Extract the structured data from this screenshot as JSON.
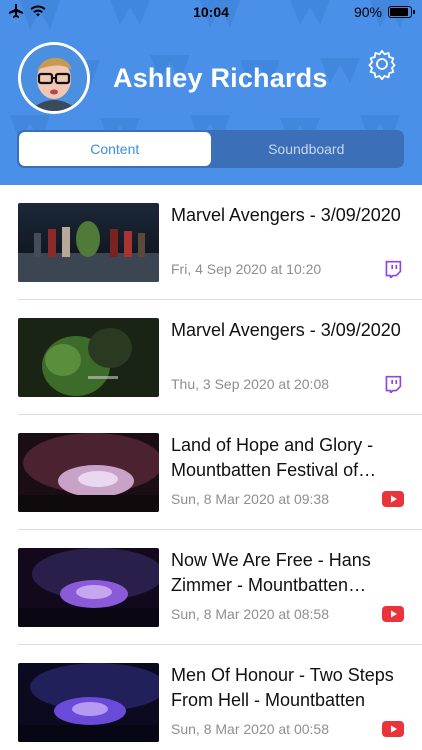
{
  "status_bar": {
    "time": "10:04",
    "battery": "90%",
    "battery_level": 0.9
  },
  "profile": {
    "name": "Ashley Richards"
  },
  "tabs": [
    {
      "label": "Content",
      "active": true
    },
    {
      "label": "Soundboard",
      "active": false
    }
  ],
  "items": [
    {
      "title": "Marvel Avengers - 3/09/2020",
      "date": "Fri, 4 Sep 2020 at 10:20",
      "source": "twitch-icon"
    },
    {
      "title": "Marvel Avengers - 3/09/2020",
      "date": "Thu, 3 Sep 2020 at 20:08",
      "source": "twitch-icon"
    },
    {
      "title": "Land of Hope and Glory - Mountbatten Festival of Music",
      "date": "Sun, 8 Mar 2020 at 09:38",
      "source": "youtube-icon"
    },
    {
      "title": "Now We Are Free - Hans Zimmer - Mountbatten Festival",
      "date": "Sun, 8 Mar 2020 at 08:58",
      "source": "youtube-icon"
    },
    {
      "title": "Men Of Honour - Two Steps From Hell - Mountbatten",
      "date": "Sun, 8 Mar 2020 at 00:58",
      "source": "youtube-icon"
    }
  ],
  "colors": {
    "header": "#4a90e8",
    "twitch": "#8e44e0",
    "youtube": "#e8343a"
  }
}
